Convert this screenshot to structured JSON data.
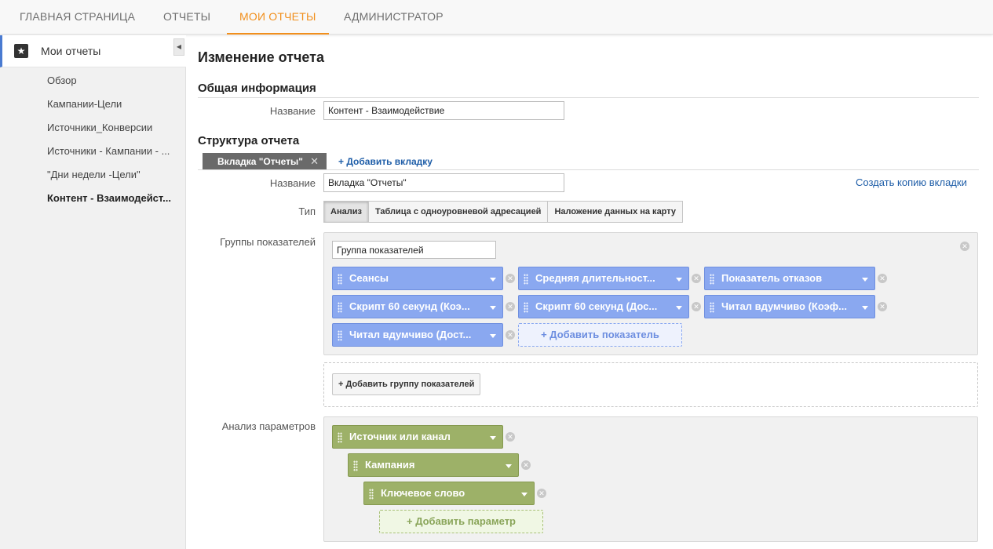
{
  "nav": {
    "tabs": [
      {
        "label": "ГЛАВНАЯ СТРАНИЦА"
      },
      {
        "label": "ОТЧЕТЫ"
      },
      {
        "label": "МОИ ОТЧЕТЫ"
      },
      {
        "label": "АДМИНИСТРАТОР"
      }
    ],
    "active": "МОИ ОТЧЕТЫ"
  },
  "sidebar": {
    "header": {
      "label": "Мои отчеты",
      "icon": "star-icon"
    },
    "collapse_glyph": "◀",
    "items": [
      {
        "label": "Обзор"
      },
      {
        "label": "Кампании-Цели"
      },
      {
        "label": "Источники_Конверсии"
      },
      {
        "label": "Источники - Кампании - ..."
      },
      {
        "label": "\"Дни недели -Цели\""
      },
      {
        "label": "Контент - Взаимодейст..."
      }
    ]
  },
  "page": {
    "title": "Изменение отчета",
    "general": {
      "heading": "Общая информация",
      "name_label": "Название",
      "name_value": "Контент - Взаимодействие"
    },
    "structure": {
      "heading": "Структура отчета",
      "tab_label": "Вкладка \"Отчеты\"",
      "tab_close": "✕",
      "add_tab": "+ Добавить вкладку",
      "name_label": "Название",
      "name_value": "Вкладка \"Отчеты\"",
      "copy_tab": "Создать копию вкладки",
      "type_label": "Тип",
      "types": [
        {
          "label": "Анализ"
        },
        {
          "label": "Таблица с одноуровневой адресацией"
        },
        {
          "label": "Наложение данных на карту"
        }
      ],
      "selected_type": "Анализ"
    },
    "metrics": {
      "label": "Группы показателей",
      "group_name": "Группа показателей",
      "chips": [
        {
          "label": "Сеансы"
        },
        {
          "label": "Средняя длительност..."
        },
        {
          "label": "Показатель отказов"
        },
        {
          "label": "Скрипт 60 секунд (Коэ..."
        },
        {
          "label": "Скрипт 60 секунд (Дос..."
        },
        {
          "label": "Читал вдумчиво (Коэф..."
        },
        {
          "label": "Читал вдумчиво (Дост..."
        }
      ],
      "add_metric": "+ Добавить показатель",
      "add_group": "+ Добавить группу показателей"
    },
    "dimensions": {
      "label": "Анализ параметров",
      "chips": [
        {
          "label": "Источник или канал"
        },
        {
          "label": "Кампания"
        },
        {
          "label": "Ключевое слово"
        }
      ],
      "add_param": "+ Добавить параметр"
    }
  },
  "colors": {
    "accent": "#f18f1c",
    "metric_chip": "#8aa8f0",
    "dimension_chip": "#9db168",
    "link": "#1f5ea8"
  }
}
